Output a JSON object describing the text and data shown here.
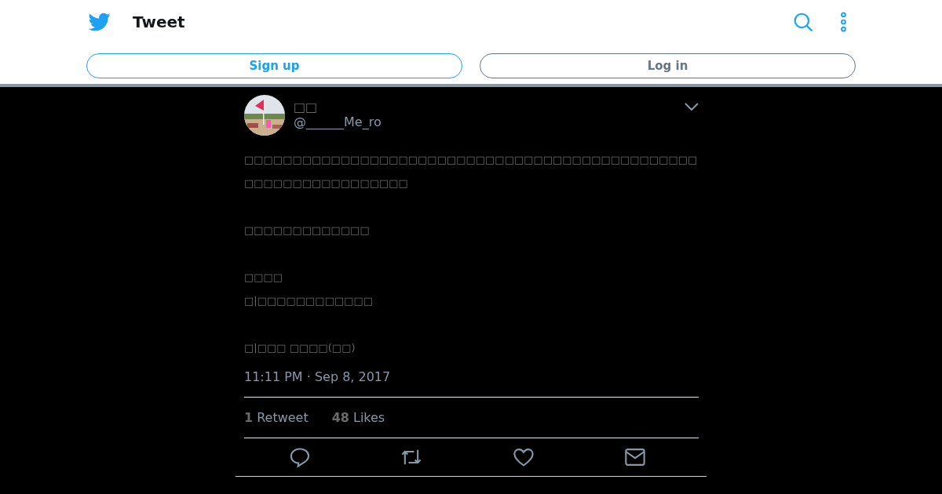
{
  "header": {
    "title": "Tweet"
  },
  "buttons": [
    {
      "label": "Sign up",
      "kind": "primary"
    },
    {
      "label": "Log in",
      "kind": "secondary"
    }
  ],
  "tweet": {
    "display_name": "□□",
    "handle": "@______Me_ro",
    "paragraphs": [
      {
        "lines": [
          "□□□□□□□□□□□□□□□□□□□□□□□□□□□□□□□□□□□□□□□□□□□□□□□",
          "□□□□□□□□□□□□□□□□□"
        ]
      },
      {
        "lines": [
          "□□□□□□□□□□□□□"
        ]
      },
      {
        "lines": [
          "□□□□",
          "□|□□□□□□□□□□□□"
        ]
      },
      {
        "lines": [
          "□|□□□ □□□□(□□)"
        ]
      }
    ],
    "timestamp": "11:11 PM · Sep 8, 2017",
    "stats": [
      {
        "count": "1",
        "label": "Retweet"
      },
      {
        "count": "48",
        "label": "Likes"
      }
    ]
  }
}
